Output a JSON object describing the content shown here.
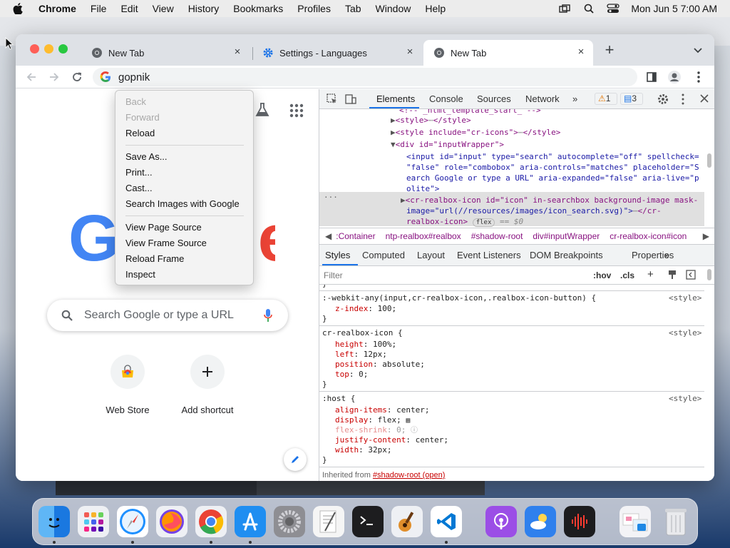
{
  "menubar": {
    "app": "Chrome",
    "items": [
      "File",
      "Edit",
      "View",
      "History",
      "Bookmarks",
      "Profiles",
      "Tab",
      "Window",
      "Help"
    ],
    "clock": "Mon Jun 5  7:00 AM"
  },
  "tabs": [
    {
      "title": "New Tab",
      "icon": "chrome-icon",
      "active": false
    },
    {
      "title": "Settings - Languages",
      "icon": "gear-icon",
      "active": false
    },
    {
      "title": "New Tab",
      "icon": "chrome-icon",
      "active": true
    }
  ],
  "omnibox": {
    "value": "gopnik"
  },
  "page": {
    "search_placeholder": "Search Google or type a URL",
    "shortcuts": [
      {
        "label": "Web Store"
      },
      {
        "label": "Add shortcut"
      }
    ]
  },
  "context_menu": {
    "items": [
      {
        "label": "Back",
        "enabled": false
      },
      {
        "label": "Forward",
        "enabled": false
      },
      {
        "label": "Reload",
        "enabled": true
      },
      {
        "label": "Save As...",
        "enabled": true
      },
      {
        "label": "Print...",
        "enabled": true
      },
      {
        "label": "Cast...",
        "enabled": true
      },
      {
        "label": "Search Images with Google",
        "enabled": true
      },
      {
        "label": "View Page Source",
        "enabled": true
      },
      {
        "label": "View Frame Source",
        "enabled": true
      },
      {
        "label": "Reload Frame",
        "enabled": true
      },
      {
        "label": "Inspect",
        "enabled": true
      }
    ]
  },
  "devtools": {
    "tabs": [
      "Elements",
      "Console",
      "Sources",
      "Network"
    ],
    "warnings": "1",
    "messages": "3",
    "dom": {
      "l0": "<!-- _html_template_start_ -->",
      "l1a": "<style>",
      "l1b": "</style>",
      "l2a": "<style include=\"cr-icons\">",
      "l2b": "</style>",
      "l3": "<div id=\"inputWrapper\">",
      "l4": "<input id=\"input\" type=\"search\" autocomplete=\"off\" spellcheck=",
      "l5": "\"false\" role=\"combobox\" aria-controls=\"matches\" placeholder=\"S",
      "l6": "earch Google or type a URL\" aria-expanded=\"false\" aria-live=\"p",
      "l7": "olite\">",
      "l8": "<cr-realbox-icon id=\"icon\" in-searchbox background-image mask-",
      "l9": "image=\"url(//resources/images/icon_search.svg)\">",
      "l9b": "</cr-",
      "l10": "realbox-icon>",
      "flex": "flex",
      "dollar": "== $0"
    },
    "breadcrumbs": [
      ":Container",
      "ntp-realbox#realbox",
      "#shadow-root",
      "div#inputWrapper",
      "cr-realbox-icon#icon"
    ],
    "subtabs": [
      "Styles",
      "Computed",
      "Layout",
      "Event Listeners",
      "DOM Breakpoints",
      "Properties"
    ],
    "filter_placeholder": "Filter",
    "hov": ":hov",
    "cls": ".cls",
    "rules": [
      {
        "selector": ":-webkit-any(input,cr-realbox-icon,.realbox-icon-button) {",
        "source": "<style>",
        "props": [
          {
            "name": "z-index",
            "value": "100;"
          }
        ]
      },
      {
        "selector": "cr-realbox-icon {",
        "source": "<style>",
        "props": [
          {
            "name": "height",
            "value": "100%;"
          },
          {
            "name": "left",
            "value": "12px;"
          },
          {
            "name": "position",
            "value": "absolute;"
          },
          {
            "name": "top",
            "value": "0;"
          }
        ]
      },
      {
        "selector": ":host {",
        "source": "<style>",
        "props": [
          {
            "name": "align-items",
            "value": "center;"
          },
          {
            "name": "display",
            "value": "flex;"
          },
          {
            "name": "flex-shrink",
            "value": "0;"
          },
          {
            "name": "justify-content",
            "value": "center;"
          },
          {
            "name": "width",
            "value": "32px;"
          }
        ]
      }
    ],
    "close_brace": "}",
    "inherited": "Inherited from",
    "inherited_src": "#shadow-root (open)"
  },
  "dock": {
    "apps": [
      "Finder",
      "Launchpad",
      "Safari",
      "Firefox",
      "Chrome",
      "App Store",
      "System Preferences",
      "TextEdit",
      "Terminal",
      "GarageBand",
      "Visual Studio Code",
      "Podcasts",
      "Weather",
      "Voice Memos",
      "Downloads",
      "Trash"
    ]
  }
}
